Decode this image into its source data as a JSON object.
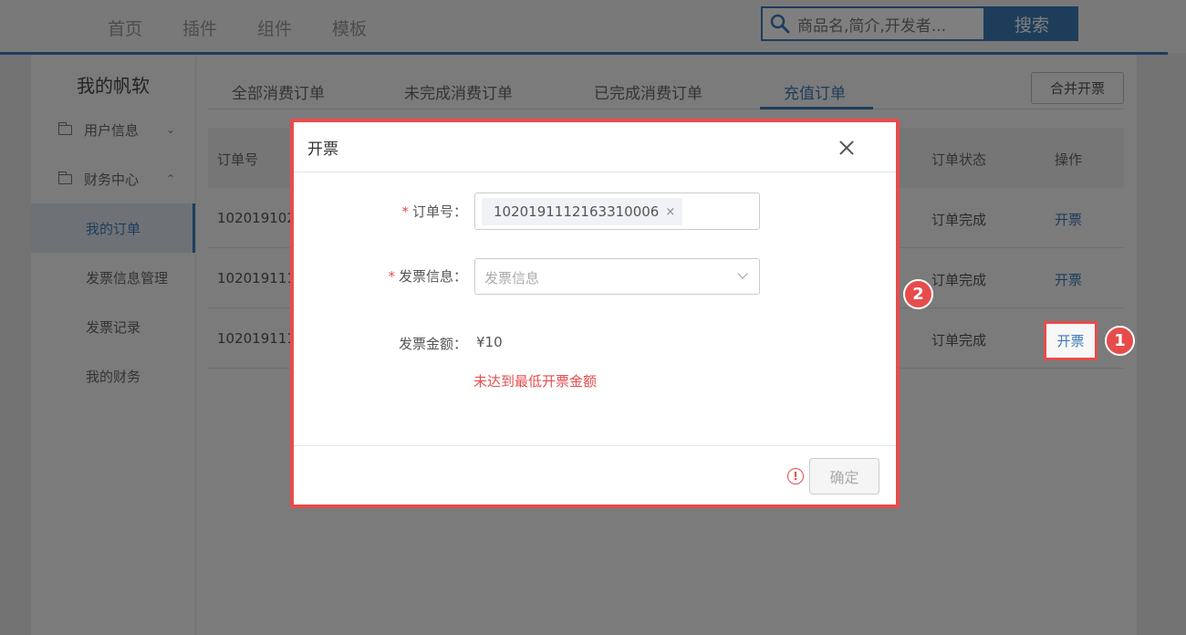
{
  "topnav": {
    "items": [
      "首页",
      "插件",
      "组件",
      "模板"
    ],
    "search_placeholder": "商品名,简介,开发者...",
    "search_button": "搜索"
  },
  "sidebar": {
    "title": "我的帆软",
    "groups": [
      {
        "label": "用户信息",
        "chevron": "⌄"
      },
      {
        "label": "财务中心",
        "chevron": "⌃"
      }
    ],
    "items": [
      "我的订单",
      "发票信息管理",
      "发票记录",
      "我的财务"
    ]
  },
  "tabs": [
    "全部消费订单",
    "未完成消费订单",
    "已完成消费订单",
    "充值订单"
  ],
  "merge_button": "合并开票",
  "table": {
    "headers": {
      "order_no": "订单号",
      "status": "订单状态",
      "action": "操作"
    },
    "rows": [
      {
        "order_no": "102019102",
        "status": "订单完成",
        "action": "开票"
      },
      {
        "order_no": "102019111",
        "status": "订单完成",
        "action": "开票"
      },
      {
        "order_no": "102019111",
        "status": "订单完成",
        "action": "开票"
      }
    ]
  },
  "modal": {
    "title": "开票",
    "order_label": "订单号",
    "order_tag": "1020191112163310006",
    "invoice_label": "发票信息",
    "invoice_placeholder": "发票信息",
    "amount_label": "发票金额",
    "amount_value": "¥10",
    "min_amount_msg": "未达到最低开票金额",
    "confirm_button": "确定"
  },
  "annotations": {
    "badge1": "1",
    "badge2": "2"
  },
  "colors": {
    "accent": "#3d7bb6",
    "highlight": "#e74c4c"
  }
}
